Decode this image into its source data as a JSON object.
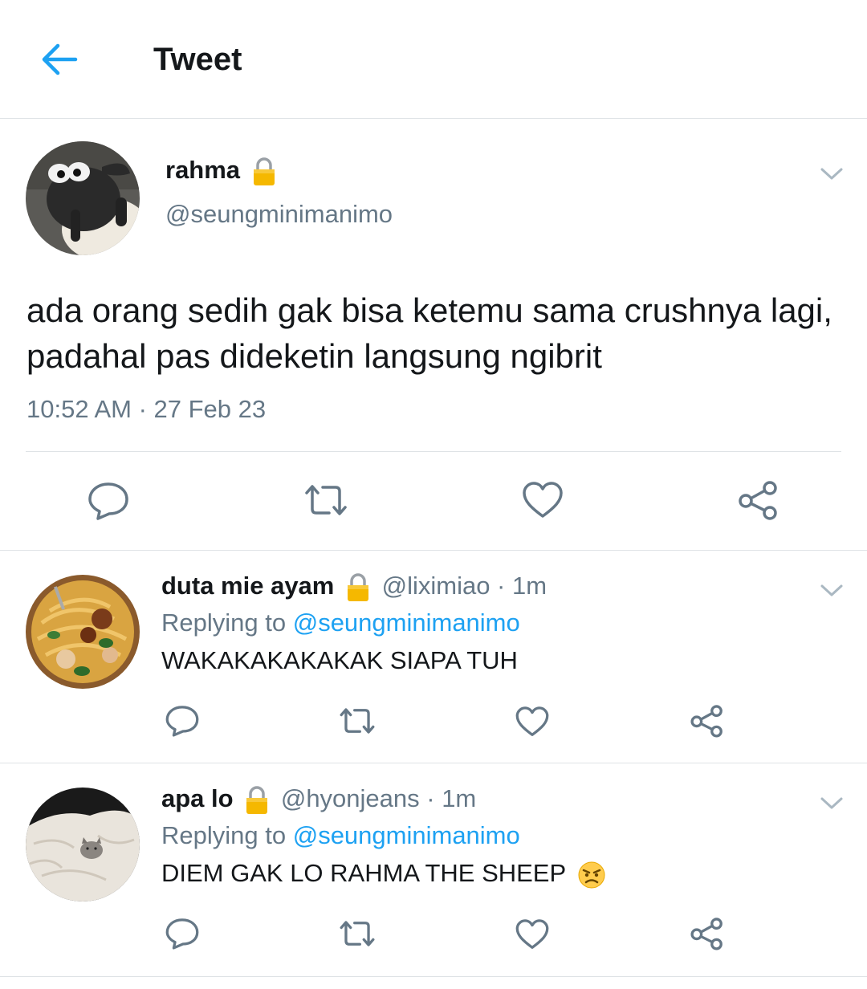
{
  "header": {
    "title": "Tweet"
  },
  "main_tweet": {
    "name": "rahma",
    "handle": "@seungminimanimo",
    "text": "ada orang sedih gak bisa ketemu sama crushnya lagi, padahal pas dideketin langsung ngibrit",
    "time": "10:52 AM · 27 Feb 23"
  },
  "replies": [
    {
      "name": "duta mie ayam",
      "meta": "@liximiao · 1m",
      "replying_prefix": "Replying to ",
      "replying_to": "@seungminimanimo",
      "text": "WAKAKAKAKAKAK SIAPA TUH"
    },
    {
      "name": "apa lo",
      "meta": "@hyonjeans · 1m",
      "replying_prefix": "Replying to ",
      "replying_to": "@seungminimanimo",
      "text": "DIEM GAK LO RAHMA THE SHEEP"
    }
  ],
  "colors": {
    "accent": "#1da1f2",
    "muted": "#657786",
    "text": "#14171a",
    "divider": "#dfe3e6",
    "lock": "#f5b800"
  },
  "icons": [
    "back-arrow-icon",
    "lock-icon",
    "chevron-down-icon",
    "reply-icon",
    "retweet-icon",
    "like-icon",
    "share-icon",
    "angry-face-icon"
  ]
}
